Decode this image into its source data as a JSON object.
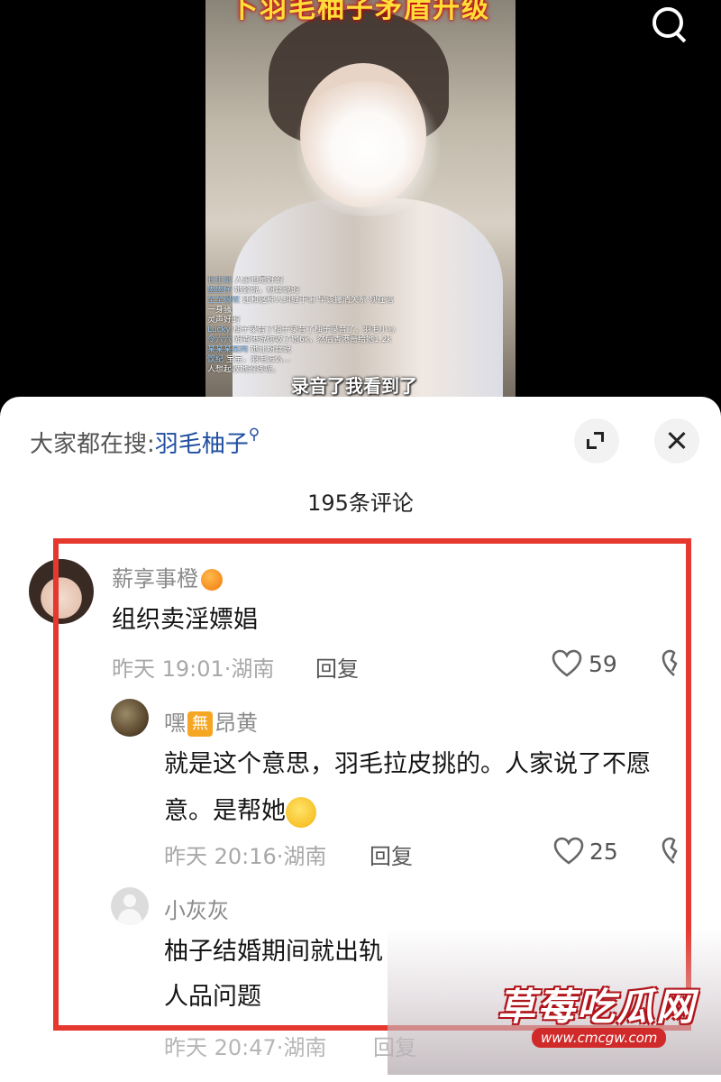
{
  "video": {
    "title_overlay": "卜羽毛柚子矛盾升级",
    "subtitle": "录音了我看到了",
    "chat": [
      {
        "user": "长生剑",
        "text": "人家也是好的"
      },
      {
        "user": "墨墨仔",
        "text": "她会说，粉丝说的"
      },
      {
        "user": "全全很攻",
        "text": "还和这种人纠缠干嘛 早该撇清关系 现在落"
      },
      {
        "user": "",
        "text": "一身骚"
      },
      {
        "user": "",
        "text": "灵声好的"
      },
      {
        "user": "Lucky",
        "text": "柚子录音了柚子录音了柚子录音了，羽毛小心"
      },
      {
        "user": "令六六",
        "text": "跟香港说你收了她6k，然后香港哥给她1.2k"
      },
      {
        "user": "某某某某网",
        "text": "她让粉丝说"
      },
      {
        "user": "饮纪",
        "text": "宝宝，羽毛怎么..."
      },
      {
        "user": "",
        "text": "人想起收她的钱呢。"
      }
    ]
  },
  "sheet": {
    "trending_prefix": "大家都在搜:",
    "trending_keyword": "羽毛柚子",
    "comment_count": "195条评论"
  },
  "comments": [
    {
      "user": "薪享事橙",
      "text": "组织卖淫嫖娼",
      "time": "昨天 19:01·湖南",
      "reply": "回复",
      "likes": "59"
    },
    {
      "user_pre": "嘿",
      "badge": "無",
      "user_post": "昂黄",
      "text": "就是这个意思，羽毛拉皮挑的。人家说了不愿意。是帮她",
      "time": "昨天 20:16·湖南",
      "reply": "回复",
      "likes": "25"
    },
    {
      "user": "小灰灰",
      "text_line1": "柚子结婚期间就出轨",
      "text_line2": "人品问题",
      "time": "昨天 20:47·湖南",
      "reply": "回复"
    }
  ],
  "watermark": {
    "title": "草莓吃瓜网",
    "url": "www.cmcgw.com"
  },
  "colors": {
    "highlight_frame": "#e5392f",
    "keyword_blue": "#1f4ea0"
  }
}
